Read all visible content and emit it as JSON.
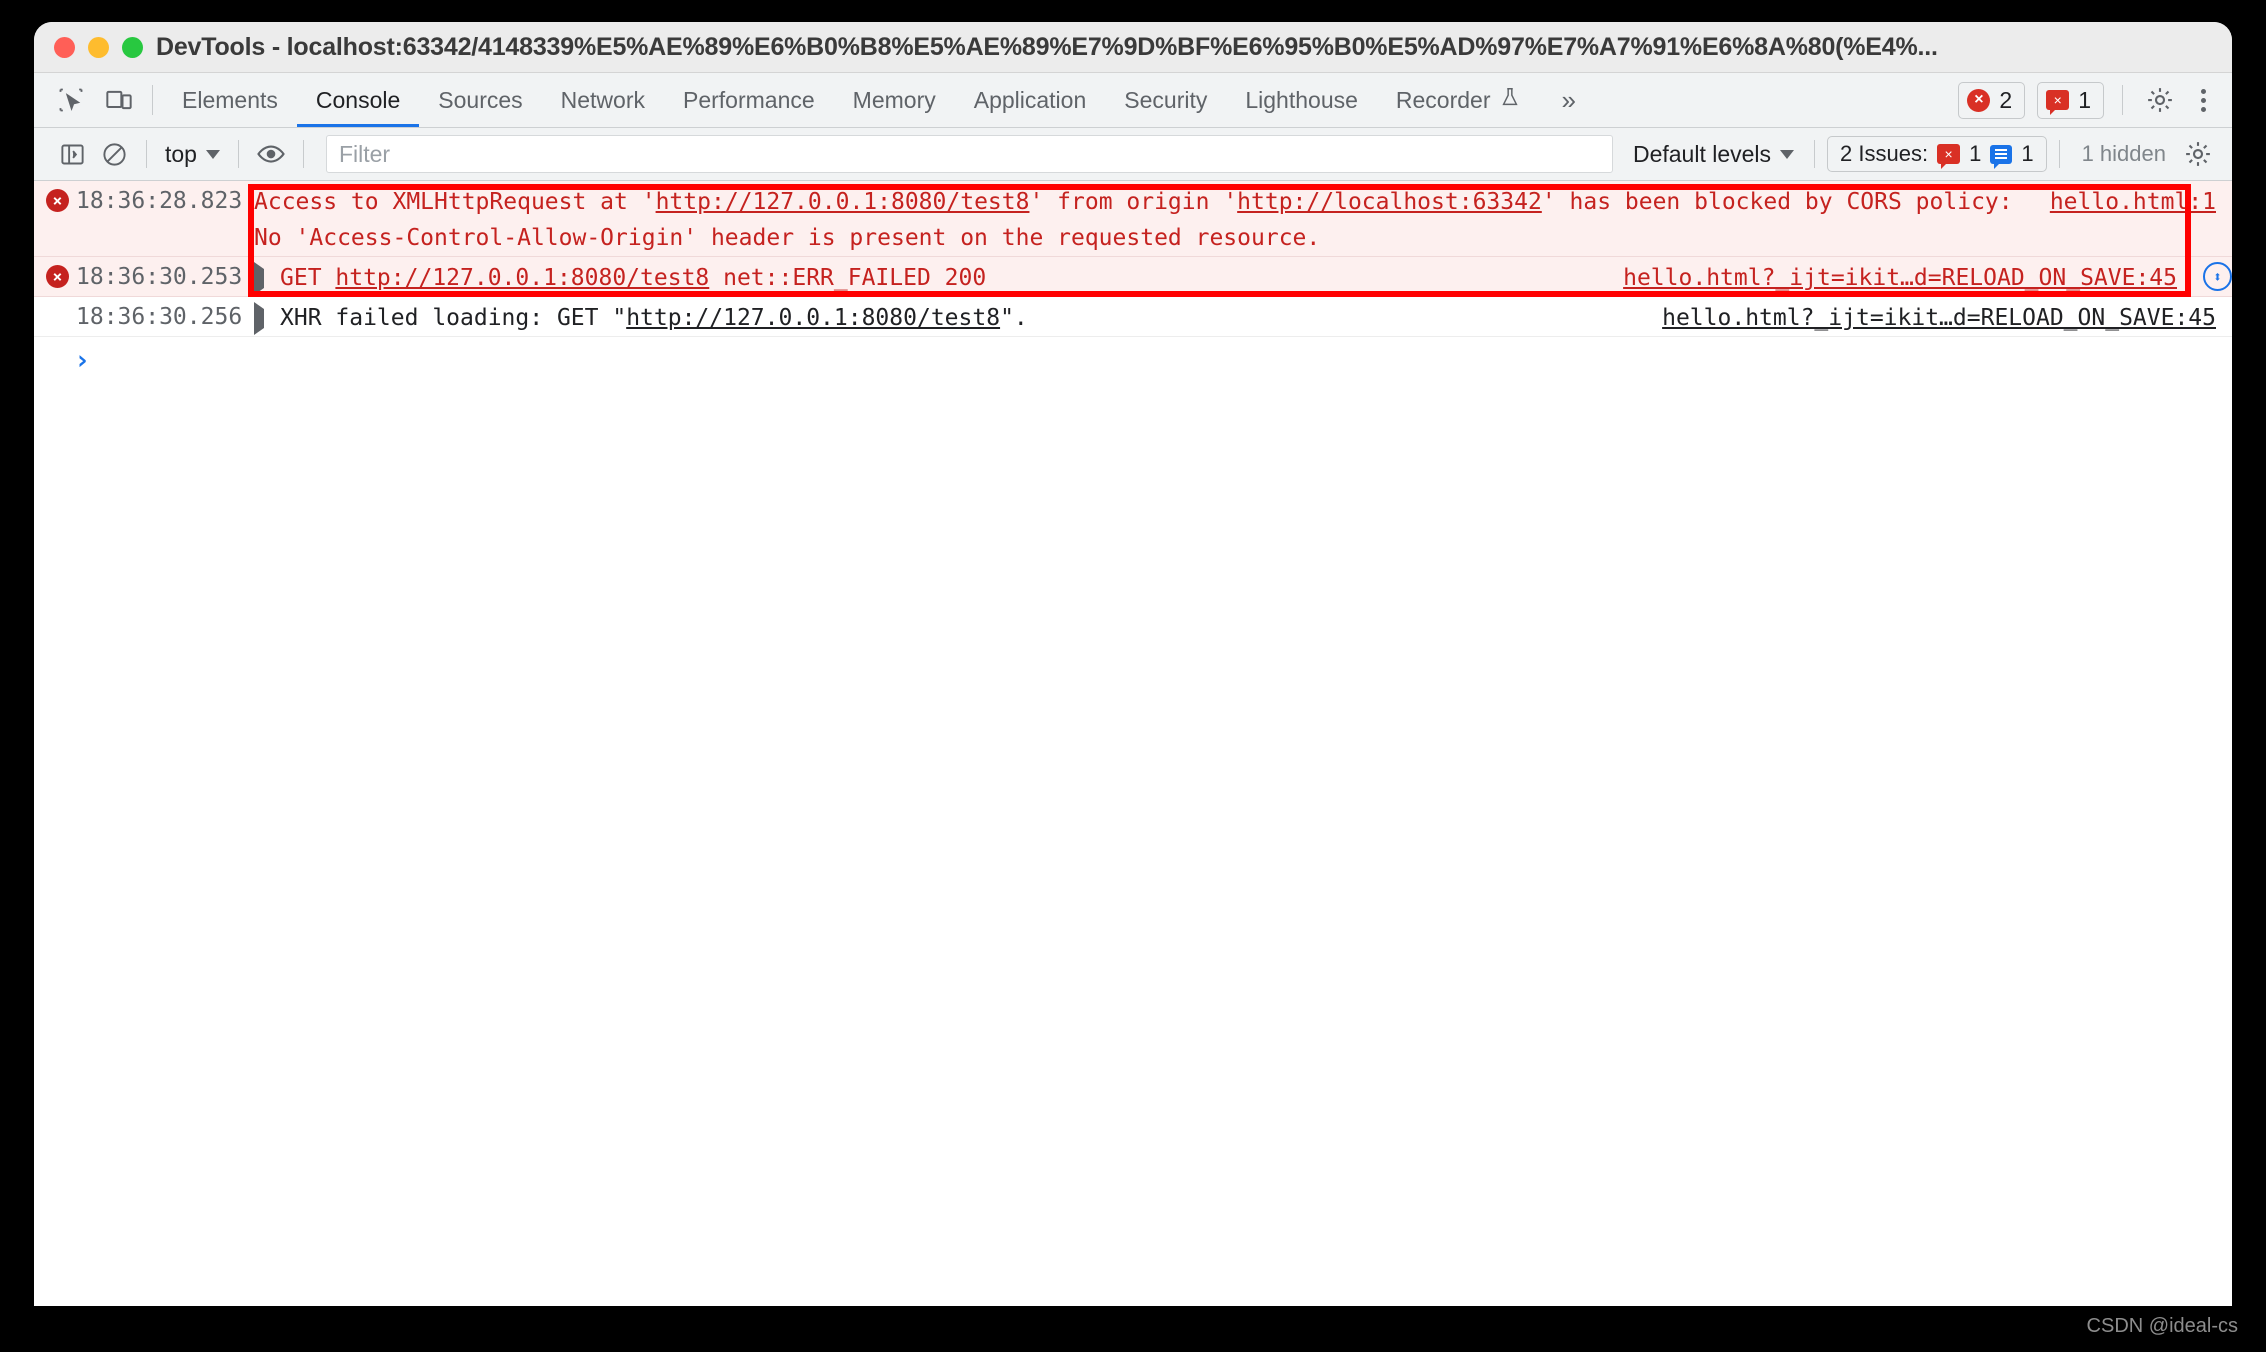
{
  "window": {
    "title": "DevTools - localhost:63342/4148339%E5%AE%89%E6%B0%B8%E5%AE%89%E7%9D%BF%E6%95%B0%E5%AD%97%E7%A7%91%E6%8A%80(%E4%...",
    "traffic_lights": [
      "close-red",
      "minimize-yellow",
      "zoom-green"
    ]
  },
  "devtools": {
    "left_icons": [
      {
        "name": "inspect-element-icon"
      },
      {
        "name": "device-toolbar-icon"
      }
    ],
    "tabs": [
      {
        "label": "Elements",
        "active": false
      },
      {
        "label": "Console",
        "active": true
      },
      {
        "label": "Sources",
        "active": false
      },
      {
        "label": "Network",
        "active": false
      },
      {
        "label": "Performance",
        "active": false
      },
      {
        "label": "Memory",
        "active": false
      },
      {
        "label": "Application",
        "active": false
      },
      {
        "label": "Security",
        "active": false
      },
      {
        "label": "Lighthouse",
        "active": false
      },
      {
        "label": "Recorder",
        "active": false,
        "flask": true
      }
    ],
    "more_tabs_label": "»",
    "error_count": "2",
    "issue_count": "1",
    "error_glyph": "×",
    "issue_glyph": "×",
    "settings_icon": "gear-icon",
    "menu_icon": "kebab-menu-icon"
  },
  "console_toolbar": {
    "sidebar_toggle": "console-sidebar-icon",
    "clear_label": "clear-console-icon",
    "context_selector": "top",
    "eye_icon": "live-expression-icon",
    "filter_placeholder": "Filter",
    "filter_value": "",
    "levels_label": "Default levels",
    "issues_label": "2 Issues:",
    "issues_error_count": "1",
    "issues_info_count": "1",
    "hidden_label": "1 hidden",
    "settings_icon": "gear-icon"
  },
  "console_messages": [
    {
      "level": "error",
      "time": "18:36:28.823",
      "expandable": false,
      "parts": [
        {
          "t": "Access to XMLHttpRequest at '",
          "link": false
        },
        {
          "t": "http://127.0.0.1:8080/test8",
          "link": true
        },
        {
          "t": "' from origin '",
          "link": false
        },
        {
          "t": "http://localhost:63342",
          "link": true
        },
        {
          "t": "' has been blocked by CORS policy: No 'Access-Control-Allow-Origin' header is present on the requested resource.",
          "link": false
        }
      ],
      "source": "hello.html:1",
      "net_icon": false
    },
    {
      "level": "error",
      "time": "18:36:30.253",
      "expandable": true,
      "parts": [
        {
          "t": "GET ",
          "link": false
        },
        {
          "t": "http://127.0.0.1:8080/test8",
          "link": true
        },
        {
          "t": " net::ERR_FAILED 200",
          "link": false
        }
      ],
      "source": "hello.html?_ijt=ikit…d=RELOAD_ON_SAVE:45",
      "net_icon": true,
      "net_icon_glyph": "⬍"
    },
    {
      "level": "plain",
      "time": "18:36:30.256",
      "expandable": true,
      "parts": [
        {
          "t": "XHR failed loading: GET \"",
          "link": false
        },
        {
          "t": "http://127.0.0.1:8080/test8",
          "link": true
        },
        {
          "t": "\".",
          "link": false
        }
      ],
      "source": "hello.html?_ijt=ikit…d=RELOAD_ON_SAVE:45",
      "net_icon": false
    }
  ],
  "prompt": {
    "caret": "›"
  },
  "annotation": {
    "color": "#ff0000"
  },
  "watermark": "CSDN @ideal-cs"
}
